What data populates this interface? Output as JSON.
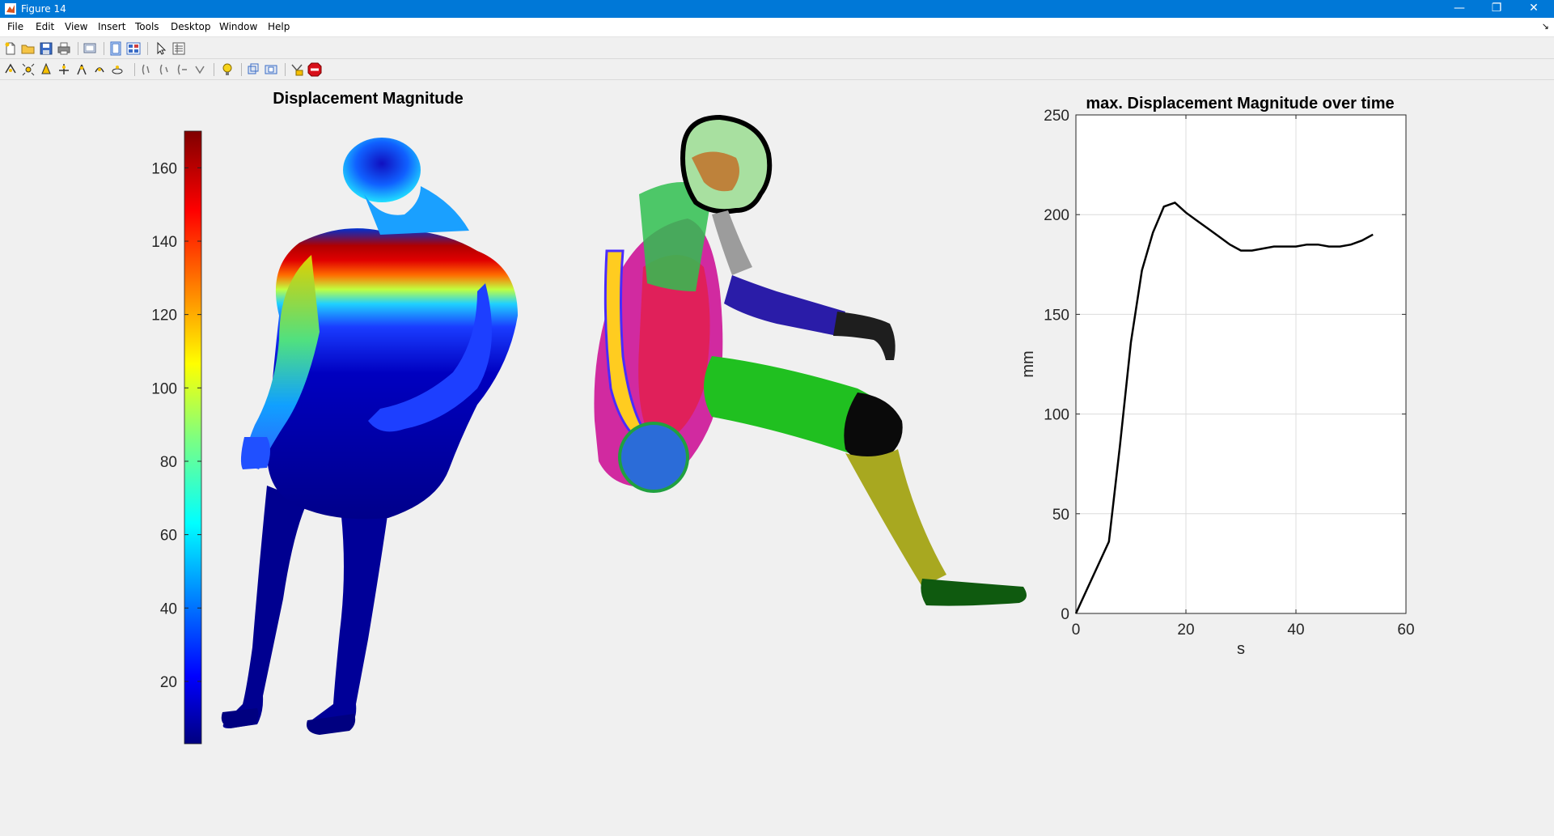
{
  "window": {
    "title": "Figure 14",
    "controls": {
      "minimize": "—",
      "restore": "❐",
      "close": "✕"
    }
  },
  "menubar": {
    "items": [
      "File",
      "Edit",
      "View",
      "Insert",
      "Tools",
      "Desktop",
      "Window",
      "Help"
    ],
    "dock_arrow": "↘"
  },
  "toolbar1": {
    "buttons": [
      "new-figure-icon",
      "open-file-icon",
      "save-icon",
      "print-icon",
      "print-preview-icon",
      "toggle-plot-tools-icon",
      "show-plot-tools-icon",
      "pointer-icon",
      "property-inspector-icon"
    ]
  },
  "toolbar2": {
    "buttons": [
      "rotate-icon",
      "zoom-in-icon",
      "zoom-out-icon",
      "pan-icon",
      "data-tips-icon",
      "camera-orbit-icon",
      "roll-icon",
      "walk-icon",
      "dolly-icon",
      "lighting-icon",
      "projection-icon",
      "scene-icon",
      "camera-icon",
      "stop-icon"
    ]
  },
  "figure": {
    "left_panel": {
      "title": "Displacement Magnitude",
      "colorbar": {
        "colormap": "jet",
        "ticks": [
          "160",
          "140",
          "120",
          "100",
          "80",
          "60",
          "40",
          "20"
        ],
        "range": [
          3,
          170
        ]
      }
    },
    "chart_data": {
      "type": "line",
      "title": "max. Displacement Magnitude over time",
      "xlabel": "s",
      "ylabel": "mm",
      "xlim": [
        0,
        60
      ],
      "ylim": [
        0,
        250
      ],
      "xticks": [
        0,
        20,
        40,
        60
      ],
      "yticks": [
        0,
        50,
        100,
        150,
        200,
        250
      ],
      "grid": true,
      "line_color": "#000000",
      "x": [
        0,
        2,
        4,
        6,
        8,
        10,
        12,
        14,
        16,
        18,
        20,
        22,
        24,
        26,
        28,
        30,
        32,
        34,
        36,
        38,
        40,
        42,
        44,
        46,
        48,
        50,
        52,
        54
      ],
      "y": [
        0,
        12,
        24,
        36,
        84,
        136,
        172,
        191,
        204,
        206,
        201,
        197,
        193,
        189,
        185,
        182,
        182,
        183,
        184,
        184,
        184,
        185,
        185,
        184,
        184,
        185,
        187,
        190
      ]
    }
  },
  "colors": {
    "titlebar": "#0078d7",
    "figure_bg": "#f0f0f0"
  }
}
